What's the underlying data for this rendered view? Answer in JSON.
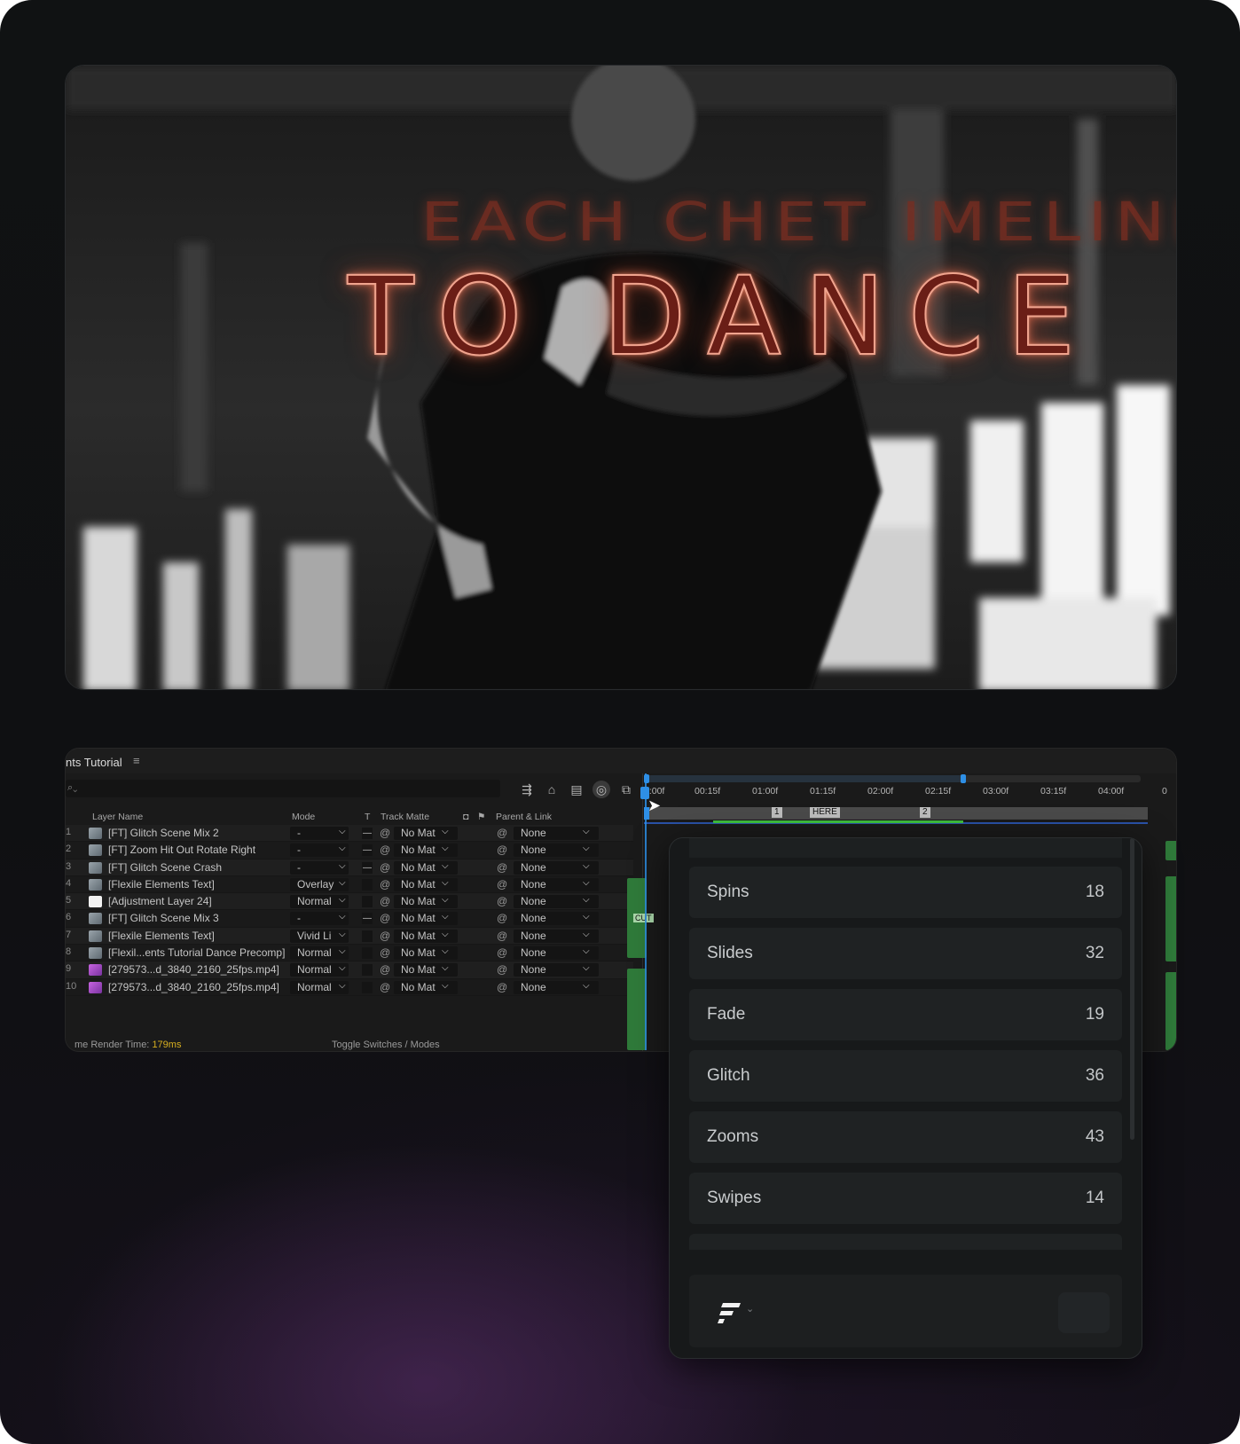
{
  "preview": {
    "headline_top": "EACH CHET IMELINE",
    "headline_main": "TO DANCE"
  },
  "timeline": {
    "tab_label": "nts Tutorial",
    "tab_menu_icon": "hamburger-menu-icon",
    "search_glyph": "⌕⌄",
    "columns": {
      "layer_name": "Layer Name",
      "mode": "Mode",
      "t": "T",
      "track_matte": "Track Matte",
      "parent_link": "Parent & Link"
    },
    "layers": [
      {
        "num": "1",
        "icon": "comp",
        "name": "[FT] Glitch Scene Mix 2",
        "mode": "-",
        "t": "—",
        "matte": "No Mat",
        "parent": "None"
      },
      {
        "num": "2",
        "icon": "comp",
        "name": "[FT] Zoom Hit Out Rotate Right",
        "mode": "-",
        "t": "—",
        "matte": "No Mat",
        "parent": "None"
      },
      {
        "num": "3",
        "icon": "comp",
        "name": "[FT] Glitch Scene Crash",
        "mode": "-",
        "t": "—",
        "matte": "No Mat",
        "parent": "None"
      },
      {
        "num": "4",
        "icon": "comp",
        "name": "[Flexile Elements Text]",
        "mode": "Overlay",
        "t": "",
        "matte": "No Mat",
        "parent": "None"
      },
      {
        "num": "5",
        "icon": "solid",
        "name": "[Adjustment Layer 24]",
        "mode": "Normal",
        "t": "",
        "matte": "No Mat",
        "parent": "None"
      },
      {
        "num": "6",
        "icon": "comp",
        "name": "[FT] Glitch Scene Mix 3",
        "mode": "-",
        "t": "—",
        "matte": "No Mat",
        "parent": "None"
      },
      {
        "num": "7",
        "icon": "comp",
        "name": "[Flexile Elements Text]",
        "mode": "Vivid Li",
        "t": "",
        "matte": "No Mat",
        "parent": "None"
      },
      {
        "num": "8",
        "icon": "comp",
        "name": "[Flexil...ents Tutorial Dance Precomp]",
        "mode": "Normal",
        "t": "",
        "matte": "No Mat",
        "parent": "None"
      },
      {
        "num": "9",
        "icon": "footage",
        "name": "[279573...d_3840_2160_25fps.mp4]",
        "mode": "Normal",
        "t": "",
        "matte": "No Mat",
        "parent": "None"
      },
      {
        "num": "10",
        "icon": "footage",
        "name": "[279573...d_3840_2160_25fps.mp4]",
        "mode": "Normal",
        "t": "",
        "matte": "No Mat",
        "parent": "None"
      }
    ],
    "ruler_ticks": [
      "0:00f",
      "00:15f",
      "01:00f",
      "01:15f",
      "02:00f",
      "02:15f",
      "03:00f",
      "03:15f",
      "04:00f",
      "0"
    ],
    "markers": [
      "1",
      "HERE",
      "2"
    ],
    "clip_marker": "CUT",
    "footer": {
      "render_label": "me Render Time:",
      "render_value": "179ms",
      "toggle_label": "Toggle Switches / Modes"
    }
  },
  "panel": {
    "categories": [
      {
        "label": "Spins",
        "count": "18"
      },
      {
        "label": "Slides",
        "count": "32"
      },
      {
        "label": "Fade",
        "count": "19"
      },
      {
        "label": "Glitch",
        "count": "36"
      },
      {
        "label": "Zooms",
        "count": "43"
      },
      {
        "label": "Swipes",
        "count": "14"
      }
    ],
    "logo_icon": "flexile-logo-icon",
    "logo_chevron": "⌄"
  },
  "colors": {
    "accent_blue": "#2e8fe6",
    "clip_green": "#2f7a3a",
    "title_glow": "#e06a4a",
    "render_yellow": "#d8b020"
  }
}
